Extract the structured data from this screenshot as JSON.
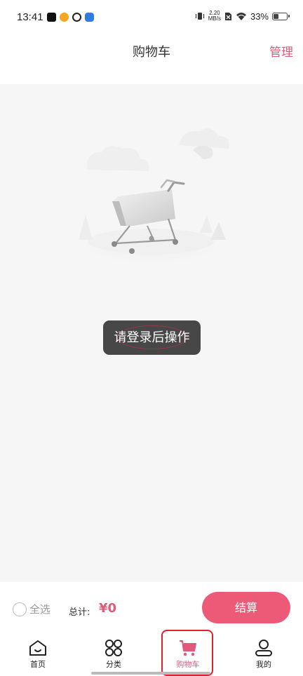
{
  "status_bar": {
    "time": "13:41",
    "network_speed_value": "2.20",
    "network_speed_unit": "MB/s",
    "battery_percent": "33%",
    "battery_level": 0.33
  },
  "header": {
    "title": "购物车",
    "manage_label": "管理"
  },
  "toast": {
    "message": "请登录后操作"
  },
  "checkout": {
    "select_all_label": "全选",
    "total_label": "总计:",
    "total_value": "¥0",
    "checkout_label": "结算"
  },
  "tabs": [
    {
      "label": "首页",
      "icon": "home-icon",
      "active": false
    },
    {
      "label": "分类",
      "icon": "category-icon",
      "active": false
    },
    {
      "label": "购物车",
      "icon": "cart-icon",
      "active": true
    },
    {
      "label": "我的",
      "icon": "profile-icon",
      "active": false
    }
  ],
  "colors": {
    "accent": "#e05a7a",
    "checkout_button": "#ec5a78",
    "highlight_box": "#e0202a",
    "content_background": "#f6f6f6"
  }
}
